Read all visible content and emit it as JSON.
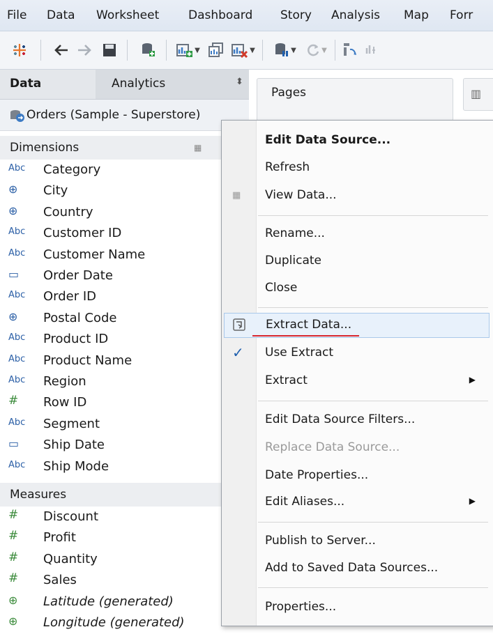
{
  "menubar": [
    "File",
    "Data",
    "Worksheet",
    "Dashboard",
    "Story",
    "Analysis",
    "Map",
    "Forr"
  ],
  "data_pane": {
    "tab_data": "Data",
    "tab_analytics": "Analytics",
    "datasource": "Orders (Sample - Superstore)",
    "dimensions_label": "Dimensions",
    "measures_label": "Measures",
    "dimensions": [
      {
        "icon": "Abc",
        "name": "Category"
      },
      {
        "icon": "globe",
        "name": "City"
      },
      {
        "icon": "globe",
        "name": "Country"
      },
      {
        "icon": "Abc",
        "name": "Customer ID"
      },
      {
        "icon": "Abc",
        "name": "Customer Name"
      },
      {
        "icon": "calendar",
        "name": "Order Date"
      },
      {
        "icon": "Abc",
        "name": "Order ID"
      },
      {
        "icon": "globe",
        "name": "Postal Code"
      },
      {
        "icon": "Abc",
        "name": "Product ID"
      },
      {
        "icon": "Abc",
        "name": "Product Name"
      },
      {
        "icon": "Abc",
        "name": "Region"
      },
      {
        "icon": "#",
        "name": "Row ID"
      },
      {
        "icon": "Abc",
        "name": "Segment"
      },
      {
        "icon": "calendar",
        "name": "Ship Date"
      },
      {
        "icon": "Abc",
        "name": "Ship Mode"
      }
    ],
    "measures": [
      {
        "icon": "#",
        "name": "Discount"
      },
      {
        "icon": "#",
        "name": "Profit"
      },
      {
        "icon": "#",
        "name": "Quantity"
      },
      {
        "icon": "#",
        "name": "Sales"
      },
      {
        "icon": "globe",
        "name": "Latitude (generated)"
      },
      {
        "icon": "globe",
        "name": "Longitude (generated)"
      }
    ],
    "icon_text": {
      "Abc": "Abc",
      "#": "#",
      "globe": "⊕",
      "calendar": "▭"
    }
  },
  "shelves": {
    "pages": "Pages"
  },
  "context_menu": {
    "edit_data_source": "Edit Data Source...",
    "refresh": "Refresh",
    "view_data": "View Data...",
    "rename": "Rename...",
    "duplicate": "Duplicate",
    "close": "Close",
    "extract_data": "Extract Data...",
    "use_extract": "Use Extract",
    "extract": "Extract",
    "edit_data_source_filters": "Edit Data Source Filters...",
    "replace_data_source": "Replace Data Source...",
    "date_properties": "Date Properties...",
    "edit_aliases": "Edit Aliases...",
    "publish_to_server": "Publish to Server...",
    "add_to_saved": "Add to Saved Data Sources...",
    "properties": "Properties..."
  },
  "colors": {
    "accent": "#1f5fae",
    "highlight": "#e8f1fb",
    "underline": "#d8262e"
  }
}
